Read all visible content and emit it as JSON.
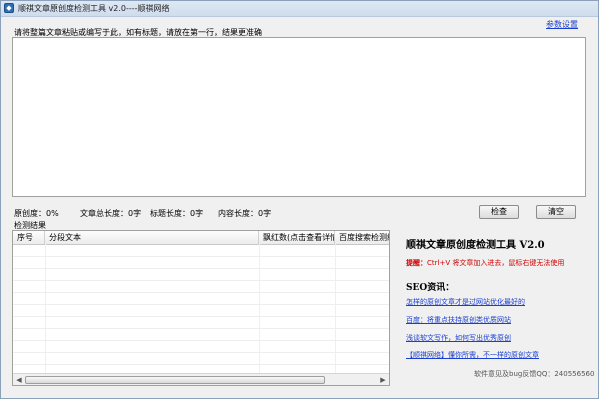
{
  "window": {
    "title": "顺祺文章原创度检测工具  v2.0----顺祺网络",
    "settings_link": "参数设置"
  },
  "input": {
    "instruction": "请将整篇文章粘贴或编写于此，如有标题，请放在第一行，结果更准确",
    "text": ""
  },
  "stats": {
    "originality": "原创度：0%",
    "total_length": "文章总长度：0字",
    "title_length": "标题长度：0字",
    "content_length": "内容长度：0字"
  },
  "buttons": {
    "check": "检查",
    "clear": "清空"
  },
  "results": {
    "label": "检测结果",
    "columns": [
      "序号",
      "分段文本",
      "飘红数(点击查看详情)",
      "百度搜索检测结果"
    ],
    "rows": []
  },
  "panel": {
    "title": "顺祺文章原创度检测工具 V2.0",
    "tip_label": "提醒：",
    "tip_text": "Ctrl+V 将文章加入进去，鼠标右键无法使用",
    "seo_heading": "SEO资讯：",
    "links": [
      "怎样的原创文章才是过网站优化最好的",
      "百度：将重点扶持原创类优质网站",
      "浅谈软文写作，如何写出优秀原创",
      "【顺祺网络】懂你所需，不一样的原创文章"
    ],
    "feedback": "软件意见及bug反馈QQ：240556560"
  }
}
